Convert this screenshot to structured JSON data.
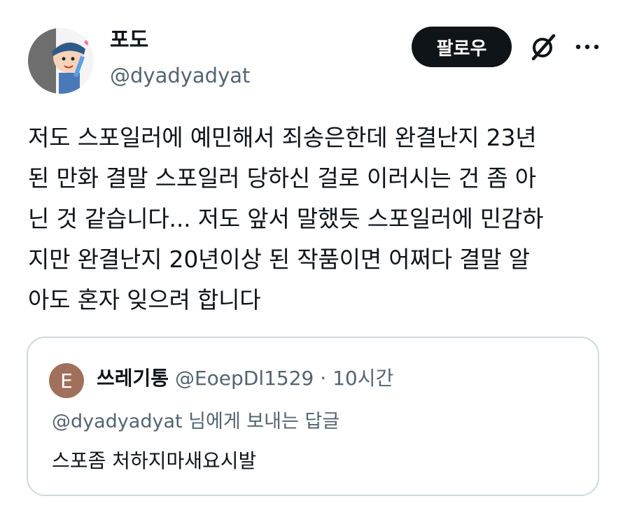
{
  "author": {
    "display_name": "포도",
    "handle": "@dyadyadyat",
    "avatar": "cartoon-avatar"
  },
  "actions": {
    "follow_label": "팔로우",
    "grok_icon": "grok-icon",
    "more_icon": "more-dots-icon"
  },
  "tweet": {
    "text": "저도 스포일러에 예민해서 죄송은한데 완결난지 23년\n된 만화 결말 스포일러 당하신 걸로 이러시는 건 좀 아\n닌 것 같습니다... 저도 앞서 말했듯 스포일러에 민감하\n지만 완결난지 20년이상 된 작품이면 어쩌다 결말 알\n아도 혼자 잊으려 합니다"
  },
  "quote": {
    "avatar_letter": "E",
    "avatar_color": "#a0705c",
    "display_name": "쓰레기통",
    "handle": "@EoepDl1529",
    "separator": "·",
    "time": "10시간",
    "reply_to": "@dyadyadyat 님에게 보내는 답글",
    "text": "스포좀 처하지마새요시발"
  },
  "colors": {
    "text_primary": "#0f1419",
    "text_secondary": "#536471",
    "button_bg": "#0f1419",
    "border": "#cfd9de"
  }
}
